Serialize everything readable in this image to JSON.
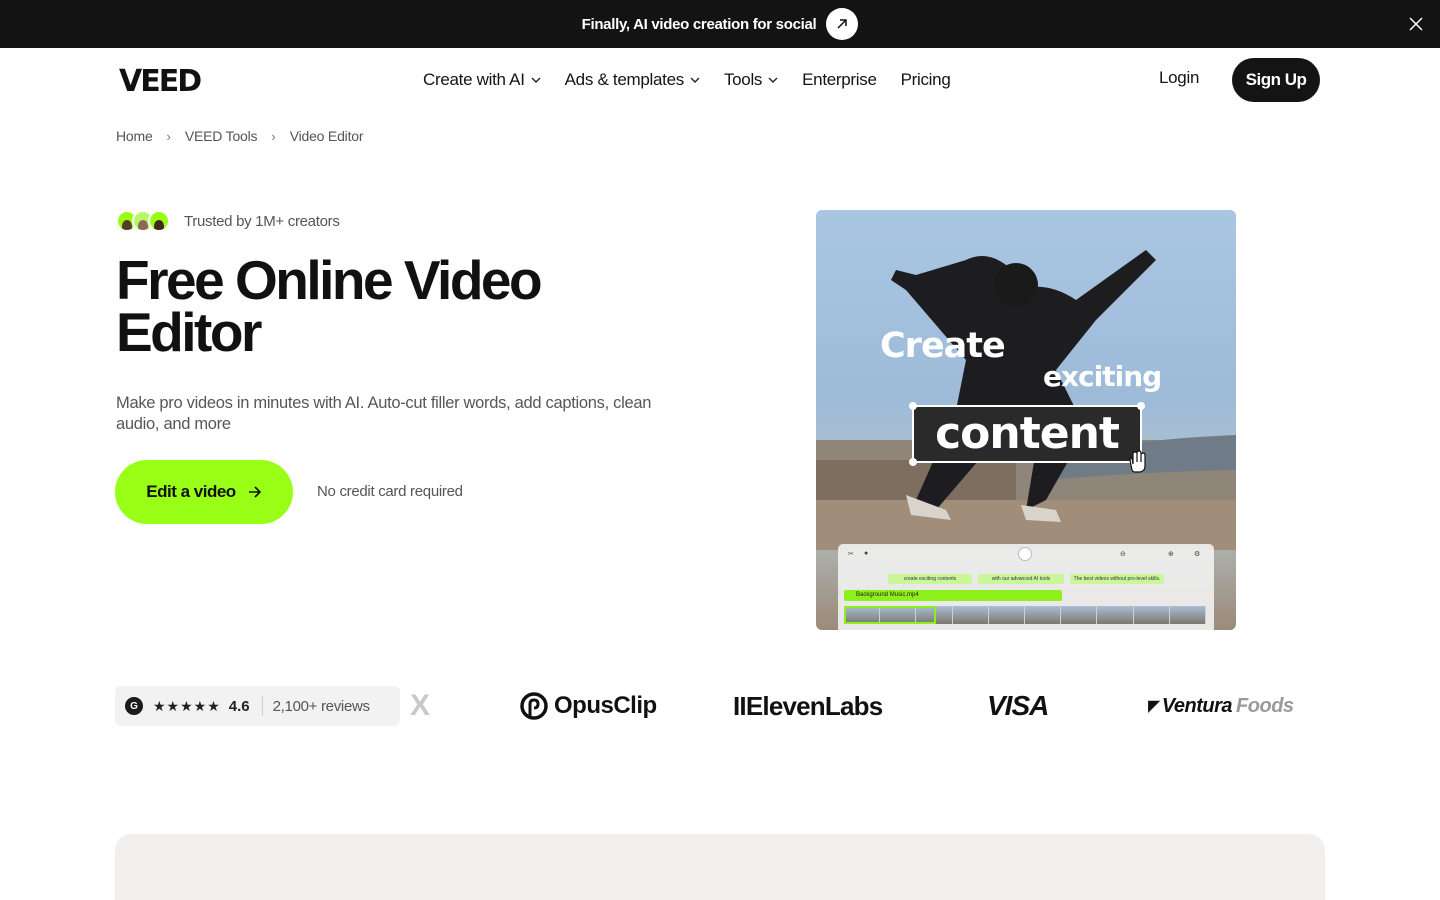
{
  "announcement": {
    "text": "Finally, AI video creation for social",
    "arrow_icon": "arrow-up-right-icon",
    "close_icon": "close-icon",
    "background": "#131313"
  },
  "nav": {
    "logo_text": "VEED",
    "links": [
      {
        "label": "Create with AI",
        "has_dropdown": true
      },
      {
        "label": "Ads & templates",
        "has_dropdown": true
      },
      {
        "label": "Tools",
        "has_dropdown": true
      },
      {
        "label": "Enterprise",
        "has_dropdown": false
      },
      {
        "label": "Pricing",
        "has_dropdown": false
      }
    ],
    "login": "Login",
    "signup": "Sign Up"
  },
  "breadcrumb": [
    "Home",
    "VEED Tools",
    "Video Editor"
  ],
  "hero": {
    "trusted": "Trusted by 1M+ creators",
    "title_line1": "Free Online Video",
    "title_line2": "Editor",
    "subtitle": "Make pro videos in minutes with AI. Auto-cut filler words, add captions, clean audio, and more",
    "cta": "Edit a video",
    "cta_icon": "arrow-right-icon",
    "note": "No credit card required",
    "accent": "#9aff17"
  },
  "media": {
    "overlay_words": [
      "Create",
      "exciting",
      "content"
    ],
    "timeline_clips": [
      "create exciting contents",
      "with our advanced AI tools",
      "The best videos without pro-level skills."
    ],
    "music_track": "Background Music.mp4"
  },
  "social_proof": {
    "g2_icon": "g2-logo-icon",
    "stars": "★★★★★",
    "rating": "4.6",
    "reviews": "2,100+ reviews",
    "brands": [
      "X",
      "OpusClip",
      "IIElevenLabs",
      "VISA",
      "Ventura",
      "Foods"
    ]
  }
}
